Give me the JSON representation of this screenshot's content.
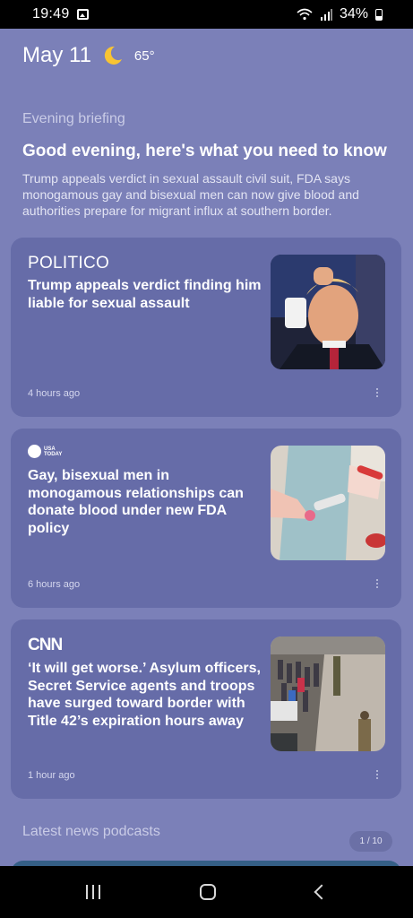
{
  "status_bar": {
    "time": "19:49",
    "battery": "34%",
    "icons": [
      "image-icon",
      "wifi-icon",
      "signal-icon",
      "battery-icon"
    ]
  },
  "header": {
    "date": "May 11",
    "weather_icon": "moon-icon",
    "temperature": "65°"
  },
  "briefing": {
    "label": "Evening briefing",
    "title": "Good evening, here's what you need to know",
    "summary": "Trump appeals verdict in sexual assault civil suit, FDA says monogamous gay and bisexual men can now give blood and authorities prepare for migrant influx at southern border."
  },
  "articles": [
    {
      "source": "POLITICO",
      "headline": "Trump appeals verdict finding him liable for sexual assault",
      "time": "4 hours ago"
    },
    {
      "source": "USA TODAY",
      "source_line1": "USA",
      "source_line2": "TODAY",
      "headline": "Gay, bisexual men in monogamous relationships can donate blood under new FDA policy",
      "time": "6 hours ago"
    },
    {
      "source": "CNN",
      "headline": "‘It will get worse.’ Asylum officers, Secret Service agents and troops have surged toward border with Title 42’s expiration hours away",
      "time": "1 hour ago"
    }
  ],
  "podcasts": {
    "label": "Latest news podcasts",
    "pager": "1 / 10"
  },
  "nav": {
    "icons": [
      "recents-icon",
      "home-icon",
      "back-icon"
    ]
  },
  "colors": {
    "background": "#7b80b8",
    "card": "#666ca8"
  }
}
